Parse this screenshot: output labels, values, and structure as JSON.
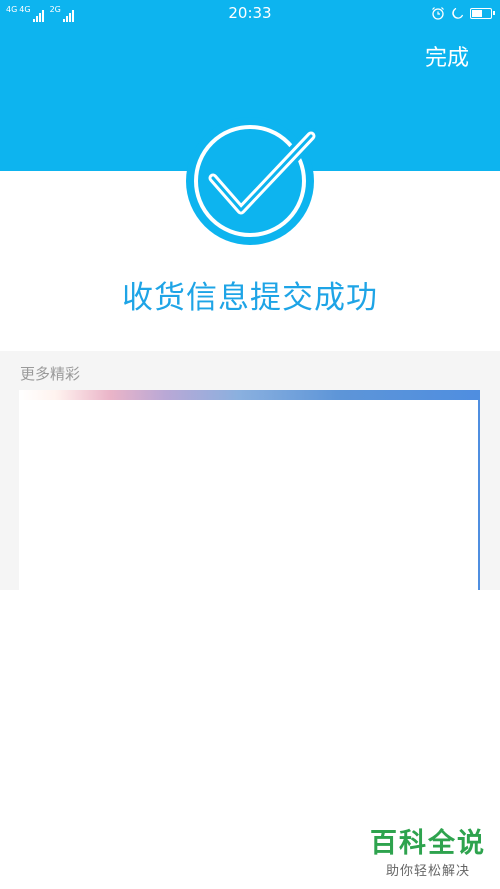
{
  "status_bar": {
    "network_left": "4G",
    "network_mid": "4G",
    "network_right": "2G",
    "time": "20:33",
    "battery_level": 0.6
  },
  "header": {
    "done_label": "完成",
    "bg_color": "#0db4ef"
  },
  "success": {
    "title": "收货信息提交成功",
    "icon": "check-circle-icon",
    "color": "#1ea4e6"
  },
  "more": {
    "title": "更多精彩"
  },
  "watermark": {
    "title": "百科全说",
    "subtitle": "助你轻松解决"
  }
}
